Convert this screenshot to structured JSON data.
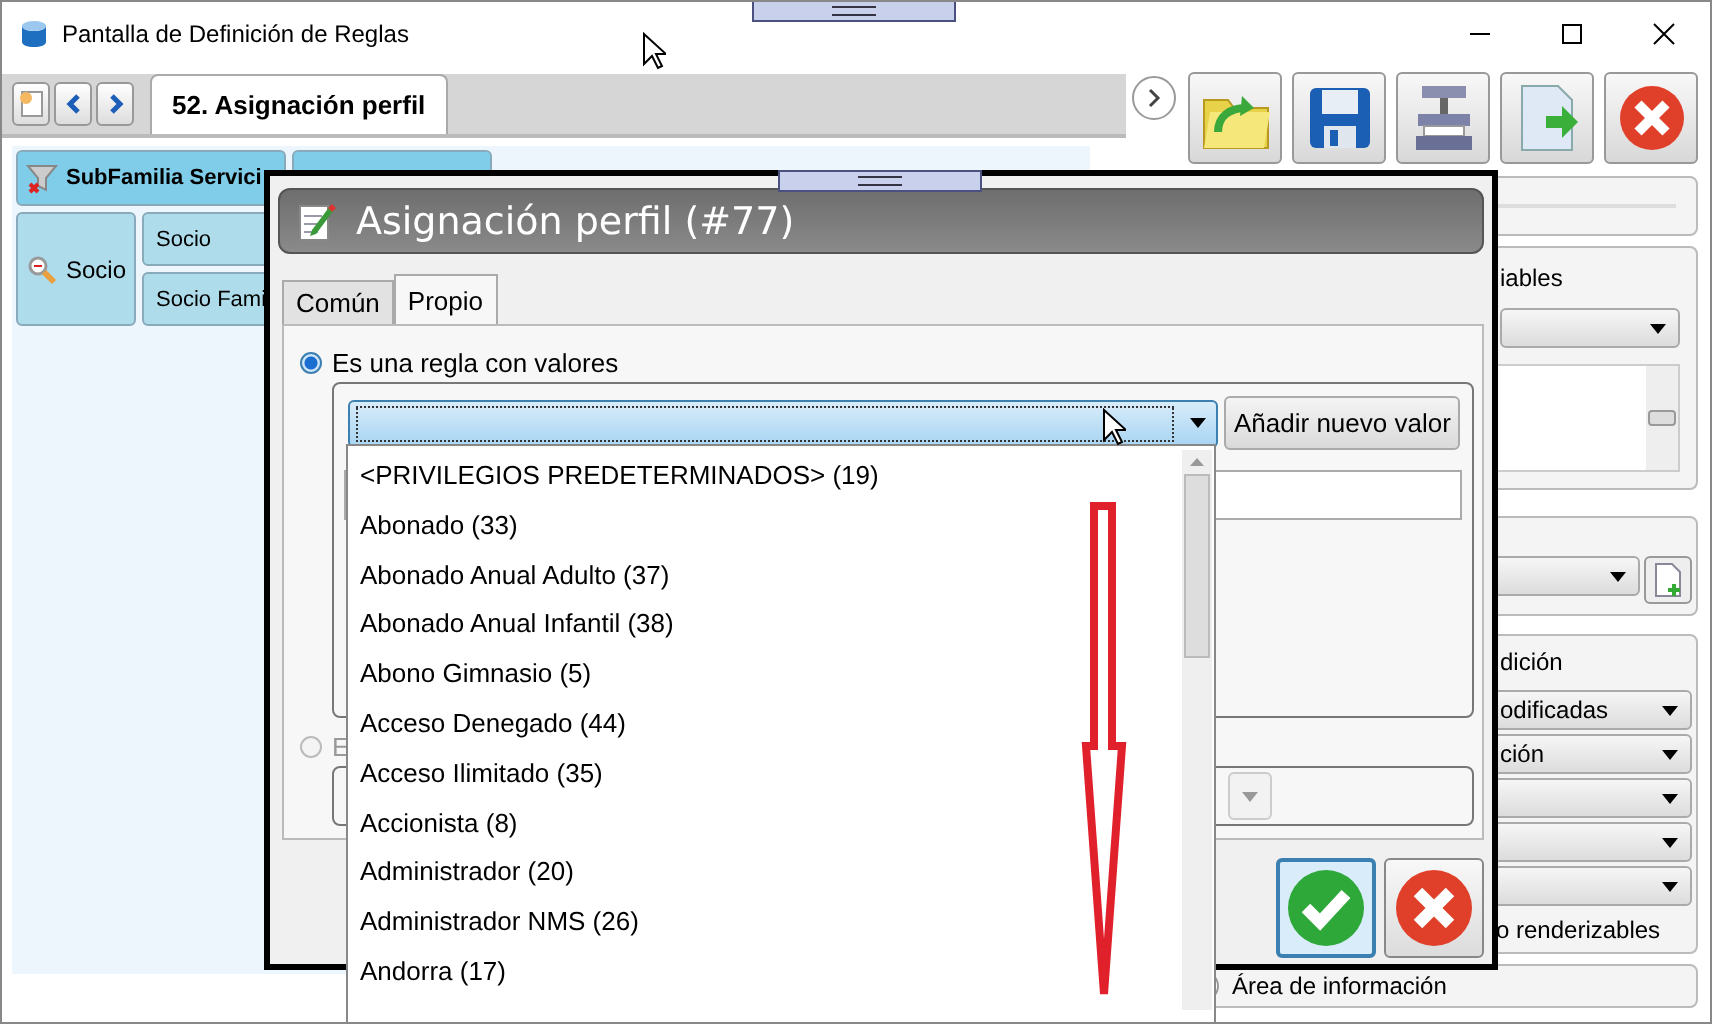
{
  "window": {
    "title": "Pantalla de Definición de Reglas"
  },
  "tabs": [
    {
      "label": "52. Asignación perfil",
      "selected": true
    }
  ],
  "left_panel": {
    "header_button": "SubFamilia Servici",
    "filter_button": "Socio",
    "options": [
      "Socio",
      "Socio Fami"
    ]
  },
  "right_panel": {
    "variables_label": "iables",
    "condition_label": "dición",
    "condition_dropdowns": [
      "odificadas",
      "ción"
    ],
    "footer_text": "o renderizables",
    "info_area": "Área de información"
  },
  "dialog": {
    "title": "Asignación perfil (#77)",
    "tabs": [
      {
        "label": "Común",
        "selected": false
      },
      {
        "label": "Propio",
        "selected": true
      }
    ],
    "options": [
      {
        "label": "Es una regla con valores",
        "selected": true,
        "disabled": false
      },
      {
        "label": "E",
        "selected": false,
        "disabled": true
      }
    ],
    "add_button": "Añadir nuevo valor",
    "dropdown": {
      "expanded": true,
      "items": [
        "<PRIVILEGIOS PREDETERMINADOS> (19)",
        "Abonado (33)",
        "Abonado Anual Adulto (37)",
        "Abonado Anual Infantil (38)",
        "Abono Gimnasio (5)",
        "Acceso Denegado (44)",
        "Acceso Ilimitado (35)",
        "Accionista (8)",
        "Administrador (20)",
        "Administrador NMS (26)",
        "Andorra (17)"
      ]
    }
  }
}
